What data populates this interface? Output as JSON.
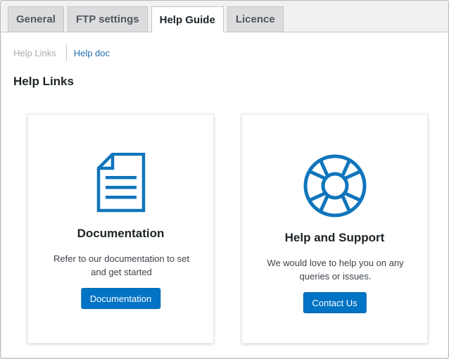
{
  "tabs": [
    {
      "label": "General",
      "active": false
    },
    {
      "label": "FTP settings",
      "active": false
    },
    {
      "label": "Help Guide",
      "active": true
    },
    {
      "label": "Licence",
      "active": false
    }
  ],
  "subnav": {
    "items": [
      {
        "label": "Help Links",
        "current": false
      },
      {
        "label": "Help doc",
        "current": true
      }
    ]
  },
  "section_title": "Help Links",
  "cards": [
    {
      "icon": "document-icon",
      "title": "Documentation",
      "description": "Refer to our documentation to set and get started",
      "button_label": "Documentation"
    },
    {
      "icon": "lifebuoy-icon",
      "title": "Help and Support",
      "description": "We would love to help you on any queries or issues.",
      "button_label": "Contact Us"
    }
  ],
  "colors": {
    "accent": "#0073c4",
    "link": "#2271b1",
    "icon": "#0f75bc"
  }
}
